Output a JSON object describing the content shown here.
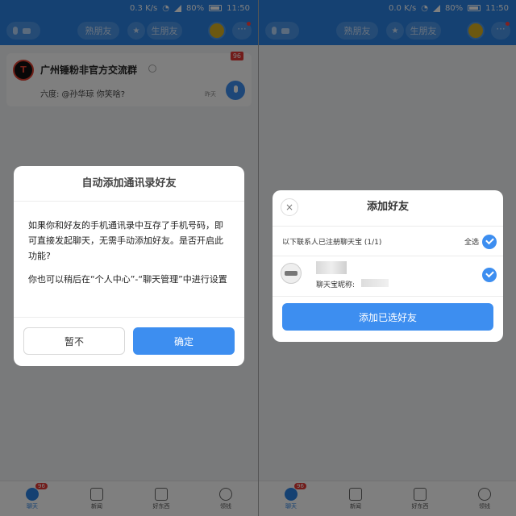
{
  "status_left": {
    "speed": "0.3 K/s",
    "battery": "80%",
    "time": "11:50"
  },
  "status_right": {
    "speed": "0.0 K/s",
    "battery": "80%",
    "time": "11:50"
  },
  "topbar": {
    "tab_hot": "熟朋友",
    "tab_star_icon": "star-icon",
    "tab_new": "生朋友",
    "more": "···"
  },
  "chat": {
    "group_avatar_letter": "T",
    "group_name": "广州锤粉非官方交流群",
    "unread": "96",
    "preview": "六度: @孙华琼 你笑啥?",
    "time": "昨天"
  },
  "nav": {
    "chat": "聊天",
    "chat_badge": "96",
    "news": "新闻",
    "goods": "好东西",
    "wallet": "领钱"
  },
  "dialog_auto": {
    "title": "自动添加通讯录好友",
    "p1": "如果你和好友的手机通讯录中互存了手机号码，即可直接发起聊天，无需手动添加好友。是否开启此功能?",
    "p2": "你也可以稍后在“个人中心”-“聊天管理”中进行设置",
    "cancel": "暂不",
    "confirm": "确定"
  },
  "dialog_add": {
    "close": "×",
    "title": "添加好友",
    "registered_text": "以下联系人已注册聊天宝 (1/1)",
    "select_all": "全选",
    "contact_name": "聊天宝昵称:",
    "add_button": "添加已选好友"
  },
  "colors": {
    "primary": "#2a82e4",
    "button_blue": "#3d8ef0",
    "badge_red": "#e53935"
  }
}
